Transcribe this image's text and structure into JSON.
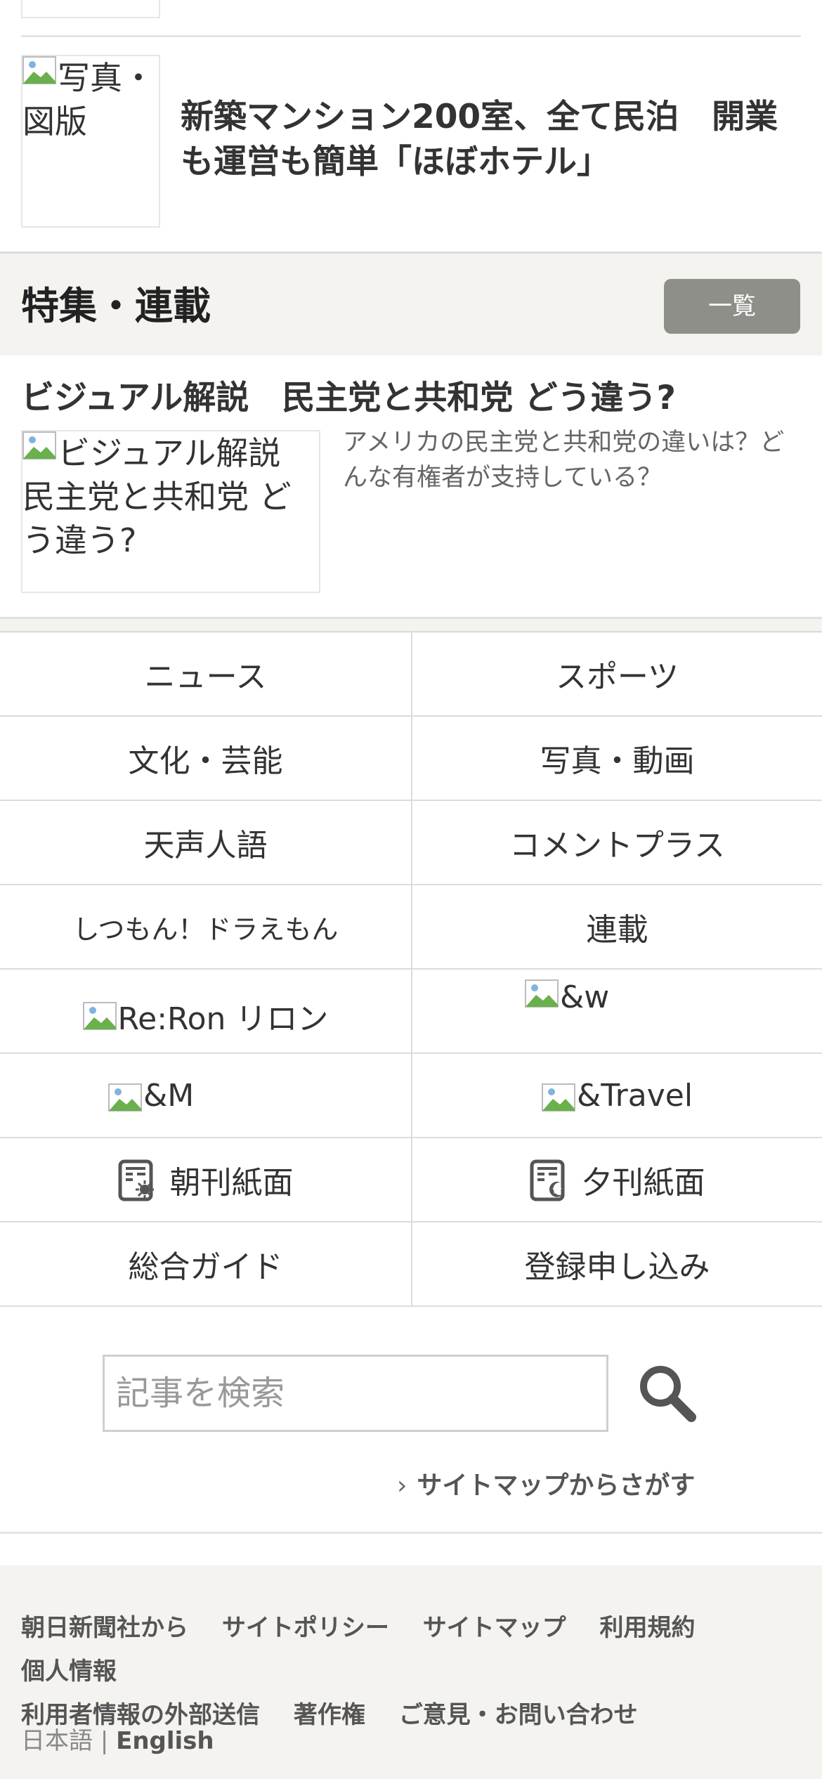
{
  "top_article": {
    "image_alt": "写真・図版",
    "headline": "新築マンション200室、全て民泊　開業も運営も簡単「ほぼホテル」"
  },
  "features_section": {
    "title": "特集・連載",
    "list_button": "一覧",
    "item": {
      "title": "ビジュアル解説　民主党と共和党 どう違う?",
      "image_alt": "ビジュアル解説　民主党と共和党 どう違う?",
      "description": "アメリカの民主党と共和党の違いは？どんな有権者が支持している？"
    }
  },
  "nav_grid": {
    "news": "ニュース",
    "sports": "スポーツ",
    "culture": "文化・芸能",
    "photo_video": "写真・動画",
    "tenseijingo": "天声人語",
    "comment_plus": "コメントプラス",
    "doraemon": "しつもん！ドラえもん",
    "series": "連載",
    "reron": "Re:Ron リロン",
    "andw": "&w",
    "andm": "&M",
    "andtravel": "&Travel",
    "morning_paper": "朝刊紙面",
    "evening_paper": "夕刊紙面",
    "guide": "総合ガイド",
    "register": "登録申し込み"
  },
  "search": {
    "placeholder": "記事を検索",
    "sitemap_link": "サイトマップからさがす"
  },
  "footer": {
    "links": [
      "朝日新聞社から",
      "サイトポリシー",
      "サイトマップ",
      "利用規約",
      "個人情報",
      "利用者情報の外部送信",
      "著作権",
      "ご意見・お問い合わせ"
    ],
    "lang_ja": "日本語",
    "lang_separator": "|",
    "lang_en": "English"
  }
}
